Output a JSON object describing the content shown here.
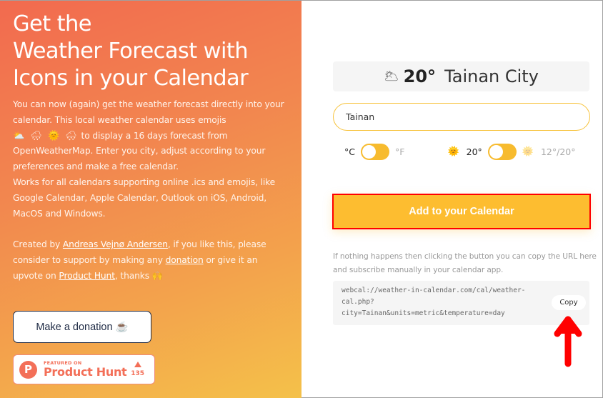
{
  "hero": {
    "title_lines": [
      "Get the",
      "Weather Forecast with",
      "Icons in your Calendar"
    ],
    "desc_1a": "You can now (again) get the weather forecast directly into your calendar. This local weather calendar uses emojis",
    "emojis": "⛅ 🌧 🌞 🌨",
    "desc_1b": " to display a 16 days forecast from OpenWeatherMap. Enter you city, adjust according to your preferences and make a free calendar.",
    "desc_2": "Works for all calendars supporting online .ics and emojis, like Google Calendar, Apple Calendar, Outlook on iOS, Android, MacOS and Windows."
  },
  "credit": {
    "prefix": "Created by ",
    "author_link": "Andreas Vejnø Andersen",
    "mid1": ", if you like this, please consider to support by making any ",
    "donation_link": "donation",
    "mid2": " or give it an upvote on ",
    "ph_link": "Product Hunt",
    "suffix": ", thanks 🙌"
  },
  "donate_button": {
    "label": "Make a donation ☕"
  },
  "product_hunt_badge": {
    "logo_letter": "P",
    "featured": "FEATURED ON",
    "name": "Product Hunt",
    "votes": "135"
  },
  "weather": {
    "icon": "🌥",
    "temp": "20°",
    "city": "Tainan City"
  },
  "city_input": {
    "value": "Tainan",
    "placeholder": ""
  },
  "toggles": {
    "unit": {
      "left": "°C",
      "right": "°F",
      "selected": "left"
    },
    "temperature": {
      "left_icon": "🌞",
      "left": "20°",
      "right_icon": "🌞",
      "right": "12°/20°",
      "selected": "left"
    }
  },
  "add_button": {
    "label": "Add to your Calendar"
  },
  "help_text": "If nothing happens then clicking the button you can copy the URL here and subscribe manually in your calendar app.",
  "url_box": {
    "url": "webcal://weather-in-calendar.com/cal/weather-\ncal.php?\ncity=Tainan&units=metric&temperature=day",
    "copy_label": "Copy"
  },
  "colors": {
    "accent": "#fdbd30",
    "annotation": "#ff0000",
    "ph_brand": "#f36f58"
  }
}
